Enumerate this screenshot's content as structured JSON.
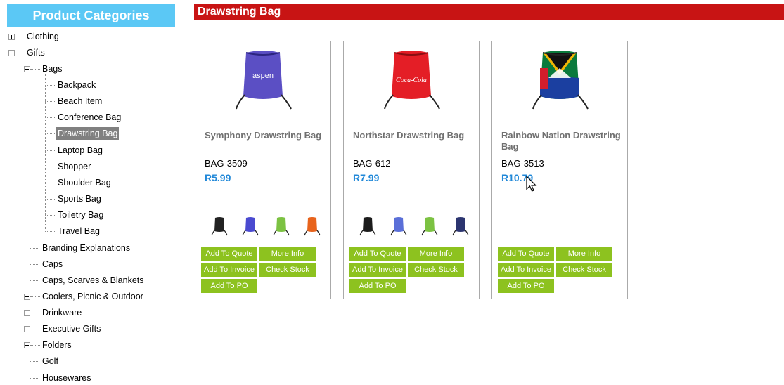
{
  "sidebar": {
    "title": "Product Categories",
    "items": [
      {
        "label": "Clothing",
        "expander": "plus"
      },
      {
        "label": "Gifts",
        "expander": "minus"
      },
      {
        "label": "Bags",
        "expander": "minus"
      },
      {
        "label": "Backpack"
      },
      {
        "label": "Beach Item"
      },
      {
        "label": "Conference Bag"
      },
      {
        "label": "Drawstring Bag",
        "selected": true
      },
      {
        "label": "Laptop Bag"
      },
      {
        "label": "Shopper"
      },
      {
        "label": "Shoulder Bag"
      },
      {
        "label": "Sports Bag"
      },
      {
        "label": "Toiletry Bag"
      },
      {
        "label": "Travel Bag"
      },
      {
        "label": "Branding Explanations"
      },
      {
        "label": "Caps"
      },
      {
        "label": "Caps, Scarves & Blankets"
      },
      {
        "label": "Coolers, Picnic & Outdoor",
        "expander": "plus"
      },
      {
        "label": "Drinkware",
        "expander": "plus"
      },
      {
        "label": "Executive Gifts",
        "expander": "plus"
      },
      {
        "label": "Folders",
        "expander": "plus"
      },
      {
        "label": "Golf"
      },
      {
        "label": "Housewares"
      }
    ]
  },
  "main": {
    "title": "Drawstring Bag",
    "buttons": {
      "add_to_quote": "Add To Quote",
      "more_info": "More Info",
      "add_to_invoice": "Add To Invoice",
      "check_stock": "Check Stock",
      "add_to_po": "Add To PO"
    },
    "products": [
      {
        "name": "Symphony Drawstring Bag",
        "code": "BAG-3509",
        "price": "R5.99",
        "image_color": "#5b4fc4",
        "image_text": "aspen",
        "swatches": [
          "#222222",
          "#4a4ad0",
          "#7cc242",
          "#e8631c"
        ]
      },
      {
        "name": "Northstar Drawstring Bag",
        "code": "BAG-612",
        "price": "R7.99",
        "image_color": "#e41e26",
        "image_text": "Coca-Cola",
        "swatches": [
          "#1c1c1c",
          "#5a6fd8",
          "#7cc242",
          "#2c3570"
        ]
      },
      {
        "name": "Rainbow Nation Drawstring Bag",
        "code": "BAG-3513",
        "price": "R10.79",
        "image_color": "#0a7a3c",
        "image_text": "",
        "swatches": []
      }
    ]
  },
  "colors": {
    "accent_blue": "#5bc8f5",
    "title_red": "#c81414",
    "button_green": "#8dc21f",
    "price_blue": "#2188d8"
  }
}
